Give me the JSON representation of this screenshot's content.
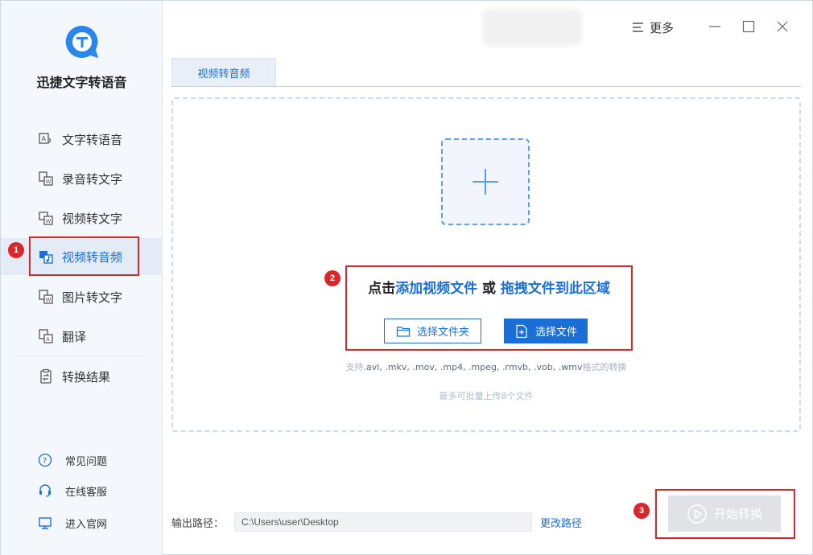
{
  "app": {
    "name": "迅捷文字转语音"
  },
  "sidebar": {
    "items": [
      {
        "label": "文字转语音",
        "icon": "text-to-speech-icon"
      },
      {
        "label": "录音转文字",
        "icon": "audio-to-text-icon"
      },
      {
        "label": "视频转文字",
        "icon": "video-to-text-icon"
      },
      {
        "label": "视频转音频",
        "icon": "video-to-audio-icon",
        "active": true
      },
      {
        "label": "图片转文字",
        "icon": "image-to-text-icon"
      },
      {
        "label": "翻译",
        "icon": "translate-icon"
      },
      {
        "label": "转换结果",
        "icon": "results-icon"
      }
    ],
    "footer": [
      {
        "label": "常见问题",
        "icon": "question-icon"
      },
      {
        "label": "在线客服",
        "icon": "headset-icon"
      },
      {
        "label": "进入官网",
        "icon": "monitor-icon"
      }
    ]
  },
  "titlebar": {
    "more_label": "更多"
  },
  "tabs": [
    {
      "label": "视频转音频"
    }
  ],
  "dropzone": {
    "title_prefix": "点击",
    "title_link1": "添加视频文件",
    "title_or": " 或 ",
    "title_link2": "拖拽文件到此区域",
    "btn_folder": "选择文件夹",
    "btn_file": "选择文件",
    "formats_prefix": "支持",
    "formats_list": ".avi, .mkv, .mov, .mp4, .mpeg, .rmvb, .vob, .wmv",
    "formats_suffix": "格式的转换",
    "limit_text": "最多可批量上传8个文件"
  },
  "output": {
    "label": "输出路径：",
    "path": "C:\\Users\\user\\Desktop",
    "change_label": "更改路径"
  },
  "start": {
    "label": "开始转换"
  },
  "annotations": {
    "step1": "1",
    "step2": "2",
    "step3": "3"
  },
  "colors": {
    "accent": "#1a6fd6",
    "annotation": "#d9262b",
    "sidebar_bg": "#f4f7fb"
  }
}
